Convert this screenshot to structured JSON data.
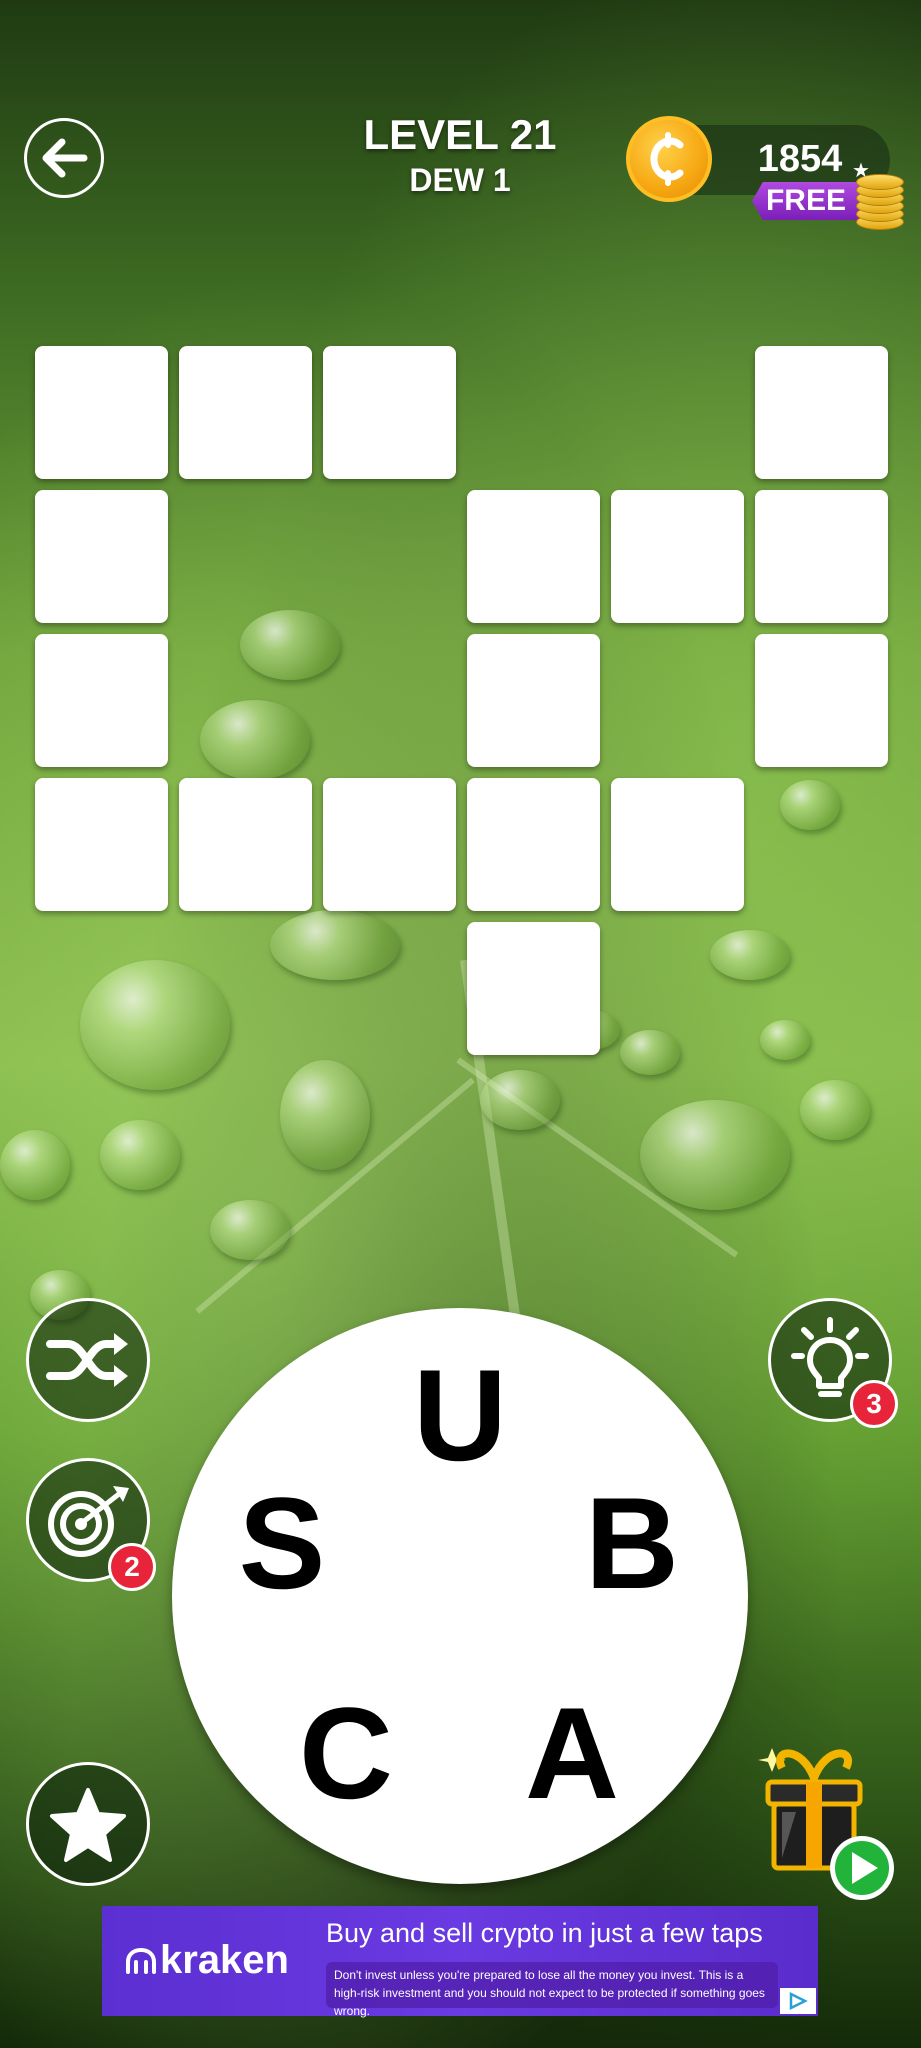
{
  "header": {
    "level_label": "LEVEL 21",
    "stage_label": "DEW 1",
    "coins": "1854",
    "free_label": "FREE"
  },
  "grid": {
    "cells": 17
  },
  "wheel": {
    "letters": [
      "U",
      "B",
      "A",
      "C",
      "S"
    ]
  },
  "tools": {
    "shuffle_icon": "shuffle-icon",
    "target_icon": "target-icon",
    "target_count": "2",
    "hint_icon": "lightbulb-icon",
    "hint_count": "3",
    "star_icon": "star-icon",
    "gift_icon": "gift-icon"
  },
  "ad": {
    "brand": "kraken",
    "headline": "Buy and sell crypto in just a few taps",
    "disclaimer": "Don't invest unless you're prepared to lose all the money you invest. This is a high-risk investment and you should not expect to be protected if something goes wrong."
  }
}
